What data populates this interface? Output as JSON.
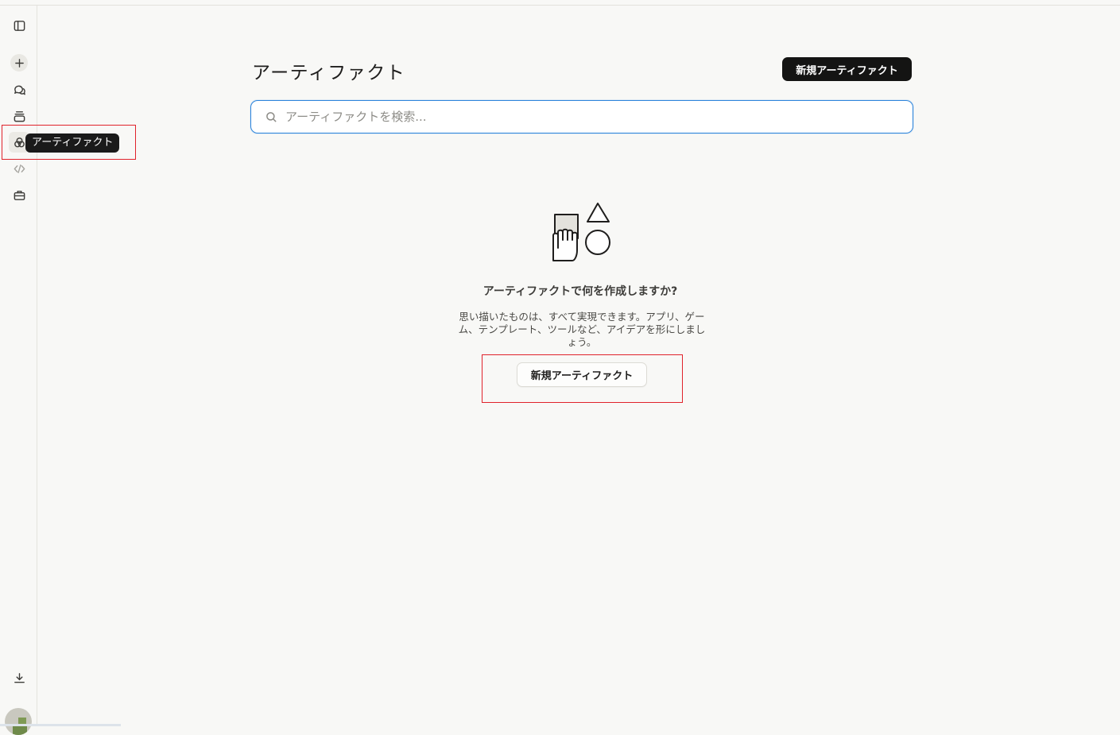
{
  "sidebar": {
    "items": [
      {
        "name": "toggle-sidebar",
        "icon": "sidebar-panel-icon"
      },
      {
        "name": "new-chat",
        "icon": "plus-icon"
      },
      {
        "name": "chats",
        "icon": "chat-bubbles-icon"
      },
      {
        "name": "projects",
        "icon": "stack-icon"
      },
      {
        "name": "artifacts",
        "icon": "shapes-icon"
      },
      {
        "name": "code",
        "icon": "code-icon"
      },
      {
        "name": "tools",
        "icon": "toolbox-icon"
      }
    ],
    "tooltip": "アーティファクト",
    "download_icon": "download-icon"
  },
  "header": {
    "title": "アーティファクト",
    "new_button_label": "新規アーティファクト"
  },
  "search": {
    "placeholder": "アーティファクトを検索..."
  },
  "empty_state": {
    "title": "アーティファクトで何を作成しますか?",
    "description": "思い描いたものは、すべて実現できます。アプリ、ゲーム、テンプレート、ツールなど、アイデアを形にしましょう。",
    "button_label": "新規アーティファクト"
  },
  "colors": {
    "background": "#f8f8f6",
    "primary_button": "#141413",
    "search_focus": "#2c84db",
    "highlight_box": "#e0222b"
  }
}
